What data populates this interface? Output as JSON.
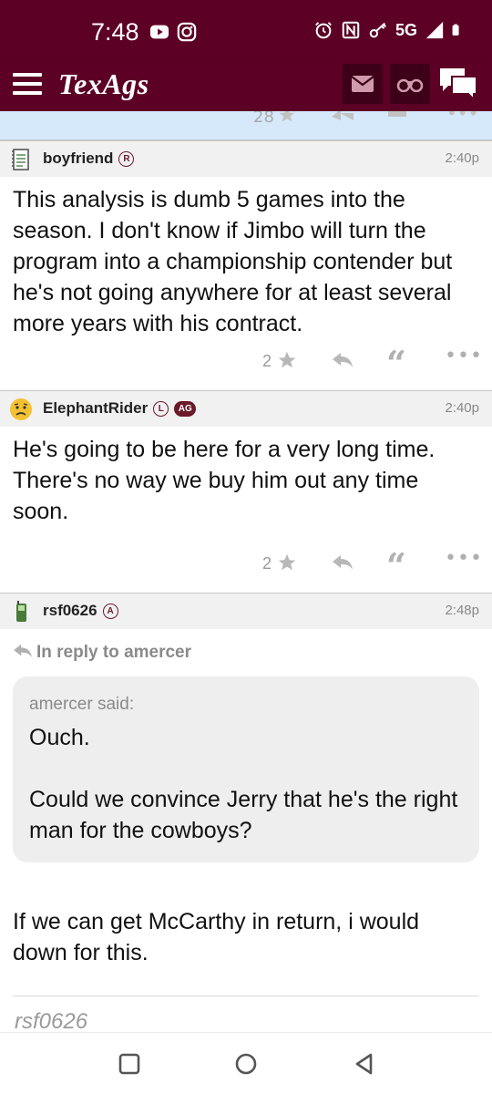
{
  "status_bar": {
    "time": "7:48",
    "network": "5G"
  },
  "header": {
    "logo": "TexAgs",
    "icons": [
      "menu-icon",
      "mail-icon",
      "binoculars-icon",
      "chat-icon"
    ]
  },
  "previous_post": {
    "count": "28"
  },
  "posts": [
    {
      "username": "boyfriend",
      "badges": [
        "R"
      ],
      "time": "2:40p",
      "body": "This analysis is dumb 5 games into the season. I don't know if Jimbo will turn the program into a championship contender but he's not going anywhere for at least several more years with his contract.",
      "stars": "2"
    },
    {
      "username": "ElephantRider",
      "badges": [
        "L",
        "AG"
      ],
      "time": "2:40p",
      "body": "He's going to be here for a very long time. There's no way we buy him out any time soon.",
      "stars": "2"
    },
    {
      "username": "rsf0626",
      "badges": [
        "A"
      ],
      "time": "2:48p",
      "in_reply": "In reply to amercer",
      "quote_author": "amercer said:",
      "quote_line1": "Ouch.",
      "quote_line2": "Could we convince Jerry that he's the right man for the cowboys?",
      "body": "If we can get McCarthy in return, i would down for this.",
      "signature": "rsf0626"
    }
  ],
  "colors": {
    "maroon": "#5c0025",
    "header_button": "#3d0018",
    "highlight": "#d6e9fb"
  }
}
